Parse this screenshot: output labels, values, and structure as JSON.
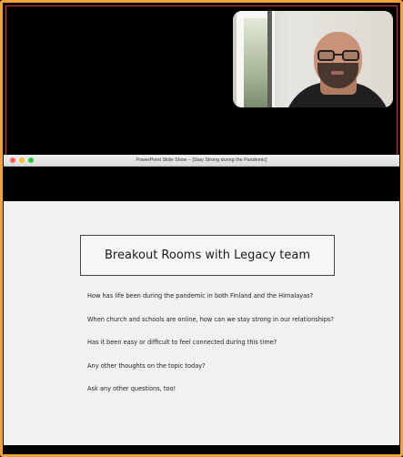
{
  "window": {
    "title": "PowerPoint Slide Show – [Stay Strong during the Pandemic]"
  },
  "slide": {
    "title": "Breakout Rooms with Legacy team",
    "questions": [
      "How has life been during the pandemic in both Finland and the Himalayas?",
      "When church and schools are online, how can we stay strong in our relationships?",
      "Has it been easy or difficult to feel connected during this time?",
      "Any other thoughts on the topic today?",
      "Ask any other questions, too!"
    ]
  },
  "colors": {
    "frame_border": "#f2a23a",
    "window_close": "#ff5f57",
    "window_minimize": "#febc2e",
    "window_zoom": "#28c840",
    "slide_background": "#f1f1f1"
  }
}
